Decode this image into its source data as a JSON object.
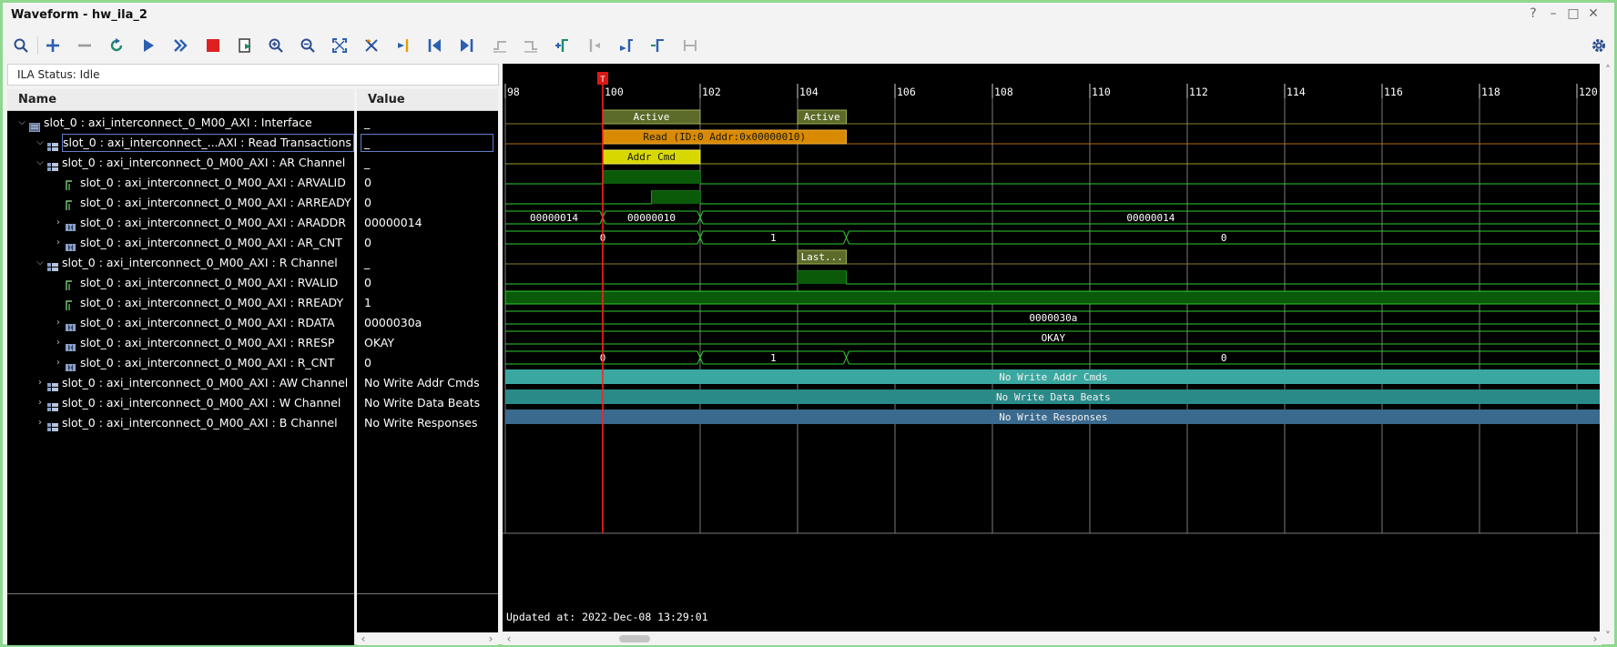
{
  "window": {
    "title": "Waveform - hw_ila_2"
  },
  "title_controls": [
    "?",
    "–",
    "□",
    "✕"
  ],
  "toolbar": {
    "buttons": [
      {
        "name": "search-icon"
      },
      {
        "name": "add-icon"
      },
      {
        "name": "remove-icon"
      },
      {
        "name": "refresh-icon"
      },
      {
        "name": "run-trigger-icon"
      },
      {
        "name": "run-immediate-icon"
      },
      {
        "name": "stop-icon"
      },
      {
        "name": "export-icon"
      },
      {
        "name": "zoom-in-icon"
      },
      {
        "name": "zoom-out-icon"
      },
      {
        "name": "zoom-fit-icon"
      },
      {
        "name": "cursor-icon"
      },
      {
        "name": "go-to-cursor-icon"
      },
      {
        "name": "go-to-start-icon"
      },
      {
        "name": "go-to-end-icon"
      },
      {
        "name": "previous-transition-icon"
      },
      {
        "name": "next-transition-icon"
      },
      {
        "name": "add-marker-icon"
      },
      {
        "name": "previous-marker-icon"
      },
      {
        "name": "next-marker-icon"
      },
      {
        "name": "swap-cursor-icon"
      },
      {
        "name": "snap-icon"
      }
    ],
    "settings_icon": "gear-icon"
  },
  "status": {
    "text": "ILA Status: Idle"
  },
  "columns": {
    "name": "Name",
    "value": "Value"
  },
  "rows": [
    {
      "indent": 0,
      "expander": "down",
      "icon": "interface",
      "name": "slot_0 : axi_interconnect_0_M00_AXI : Interface",
      "value": "_"
    },
    {
      "indent": 1,
      "expander": "down",
      "icon": "bus",
      "name": "slot_0 : axi_interconnect_...AXI : Read Transactions",
      "value": "_",
      "selected": true
    },
    {
      "indent": 1,
      "expander": "down",
      "icon": "bus",
      "name": "slot_0 : axi_interconnect_0_M00_AXI : AR Channel",
      "value": "_"
    },
    {
      "indent": 2,
      "expander": "",
      "icon": "signal",
      "name": "slot_0 : axi_interconnect_0_M00_AXI : ARVALID",
      "value": "0"
    },
    {
      "indent": 2,
      "expander": "",
      "icon": "signal",
      "name": "slot_0 : axi_interconnect_0_M00_AXI : ARREADY",
      "value": "0"
    },
    {
      "indent": 2,
      "expander": "right",
      "icon": "vector",
      "name": "slot_0 : axi_interconnect_0_M00_AXI : ARADDR",
      "value": "00000014"
    },
    {
      "indent": 2,
      "expander": "right",
      "icon": "vector",
      "name": "slot_0 : axi_interconnect_0_M00_AXI : AR_CNT",
      "value": "0"
    },
    {
      "indent": 1,
      "expander": "down",
      "icon": "bus",
      "name": "slot_0 : axi_interconnect_0_M00_AXI : R Channel",
      "value": "_"
    },
    {
      "indent": 2,
      "expander": "",
      "icon": "signal",
      "name": "slot_0 : axi_interconnect_0_M00_AXI : RVALID",
      "value": "0"
    },
    {
      "indent": 2,
      "expander": "",
      "icon": "signal",
      "name": "slot_0 : axi_interconnect_0_M00_AXI : RREADY",
      "value": "1"
    },
    {
      "indent": 2,
      "expander": "right",
      "icon": "vector",
      "name": "slot_0 : axi_interconnect_0_M00_AXI : RDATA",
      "value": "0000030a"
    },
    {
      "indent": 2,
      "expander": "right",
      "icon": "vector",
      "name": "slot_0 : axi_interconnect_0_M00_AXI : RRESP",
      "value": "OKAY"
    },
    {
      "indent": 2,
      "expander": "right",
      "icon": "vector",
      "name": "slot_0 : axi_interconnect_0_M00_AXI : R_CNT",
      "value": "0"
    },
    {
      "indent": 1,
      "expander": "right",
      "icon": "bus",
      "name": "slot_0 : axi_interconnect_0_M00_AXI : AW Channel",
      "value": "No Write Addr Cmds"
    },
    {
      "indent": 1,
      "expander": "right",
      "icon": "bus",
      "name": "slot_0 : axi_interconnect_0_M00_AXI : W Channel",
      "value": "No Write Data Beats"
    },
    {
      "indent": 1,
      "expander": "right",
      "icon": "bus",
      "name": "slot_0 : axi_interconnect_0_M00_AXI : B Channel",
      "value": "No Write Responses"
    }
  ],
  "waveform": {
    "time_ticks": [
      "98",
      "100",
      "102",
      "104",
      "106",
      "108",
      "110",
      "112",
      "114",
      "116",
      "118",
      "120"
    ],
    "trigger_marker": "T",
    "cursor_time": 100,
    "updated_at": "Updated at:  2022-Dec-08 13:29:01",
    "labels": {
      "active_1": "Active",
      "active_2": "Active",
      "read_txn": "Read (ID:0 Addr:0x00000010)",
      "addr_cmd": "Addr Cmd",
      "araddr_a": "00000014",
      "araddr_b": "00000010",
      "araddr_c": "00000014",
      "ar_cnt_a": "0",
      "ar_cnt_b": "1",
      "ar_cnt_c": "0",
      "last": "Last...",
      "rdata": "0000030a",
      "rresp": "OKAY",
      "r_cnt_a": "0",
      "r_cnt_b": "1",
      "r_cnt_c": "0",
      "aw": "No Write Addr Cmds",
      "w": "No Write Data Beats",
      "b": "No Write Responses"
    }
  },
  "colors": {
    "active": "#5c6b2a",
    "read_txn": "#d98a00",
    "addr_cmd": "#d8d800",
    "signal_green": "#2ecc2e",
    "cursor_red": "#ff2020",
    "aw": "#3aa8a0",
    "w": "#2a8a88",
    "b": "#3a6a8e"
  }
}
